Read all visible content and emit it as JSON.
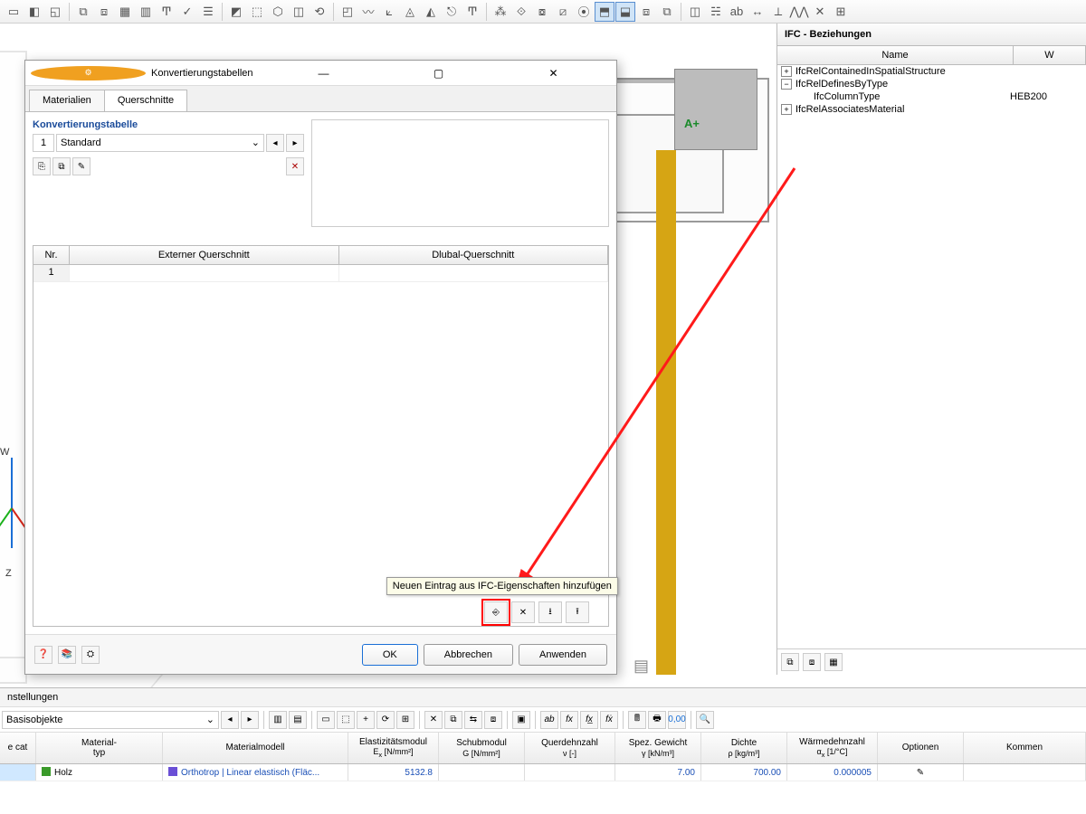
{
  "top_toolbar_icon_count": 40,
  "dialog": {
    "title": "Konvertierungstabellen",
    "tabs": {
      "materials": "Materialien",
      "sections": "Querschnitte"
    },
    "section_title": "Konvertierungstabelle",
    "num": "1",
    "selection": "Standard",
    "grid": {
      "head_nr": "Nr.",
      "head_ext": "Externer Querschnitt",
      "head_dlu": "Dlubal-Querschnitt",
      "row_nr": "1"
    },
    "tooltip": "Neuen Eintrag aus IFC-Eigenschaften hinzufügen",
    "buttons": {
      "ok": "OK",
      "cancel": "Abbrechen",
      "apply": "Anwenden"
    }
  },
  "ifc": {
    "panel_title": "IFC - Beziehungen",
    "col_name": "Name",
    "col_val": "W",
    "rows": {
      "r1": "IfcRelContainedInSpatialStructure",
      "r2": "IfcRelDefinesByType",
      "r2a_name": "IfcColumnType",
      "r2a_val": "HEB200",
      "r3": "IfcRelAssociatesMaterial"
    }
  },
  "axis": {
    "w": "W",
    "z": "Z"
  },
  "settings": {
    "title": "nstellungen",
    "selector": "Basisobjekte"
  },
  "material": {
    "head": {
      "cat": "e cat",
      "typ_l1": "Material-",
      "typ_l2": "typ",
      "mod": "Materialmodell",
      "e_l1": "Elastizitätsmodul",
      "e_l2": "E<sub>x</sub> [N/mm²]",
      "g_l1": "Schubmodul",
      "g_l2": "G [N/mm²]",
      "nu_l1": "Querdehnzahl",
      "nu_l2": "ν [-]",
      "gam_l1": "Spez. Gewicht",
      "gam_l2": "γ [kN/m³]",
      "rho_l1": "Dichte",
      "rho_l2": "ρ [kg/m³]",
      "alp_l1": "Wärmedehnzahl",
      "alp_l2": "α<sub>x</sub> [1/°C]",
      "opt": "Optionen",
      "kom": "Kommen"
    },
    "row": {
      "typ": "Holz",
      "mod": "Orthotrop | Linear elastisch (Fläc...",
      "e": "5132.8",
      "g": "",
      "nu": "",
      "gam": "7.00",
      "rho": "700.00",
      "alp": "0.000005"
    }
  }
}
